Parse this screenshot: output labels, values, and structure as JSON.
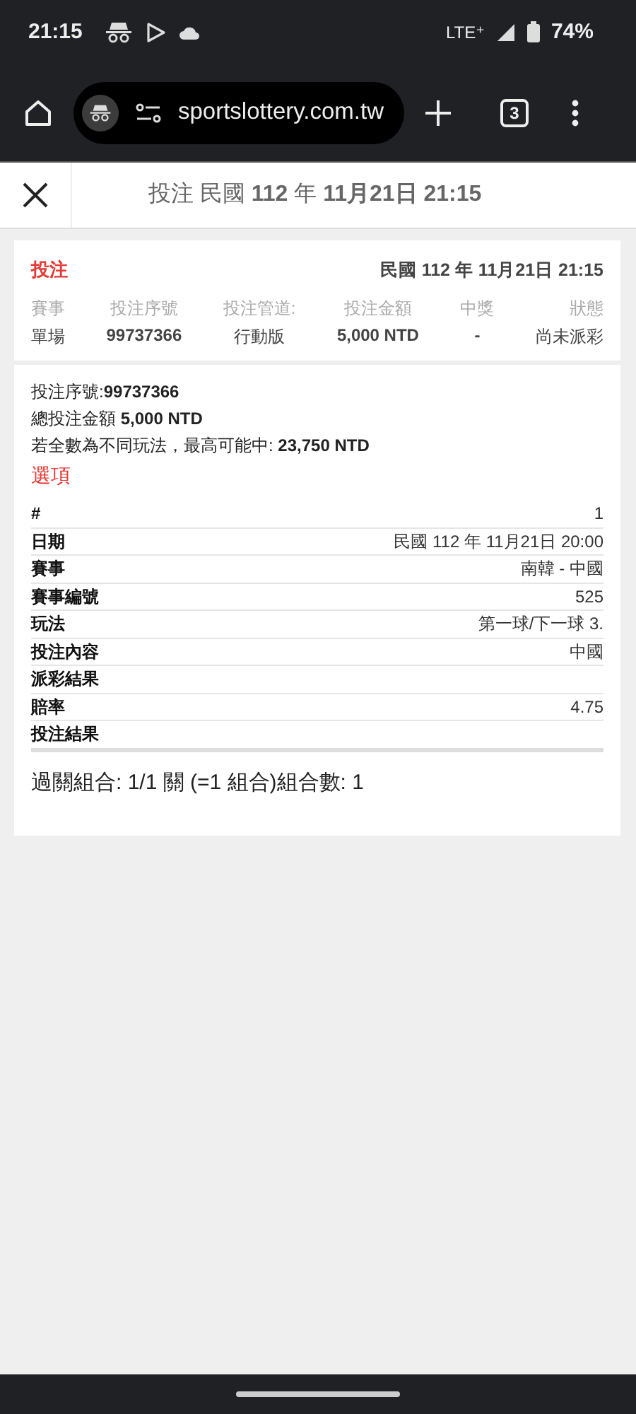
{
  "status_bar": {
    "time": "21:15",
    "network": "LTE⁺",
    "battery": "74%"
  },
  "browser": {
    "url": "sportslottery.com.tw",
    "tab_count": "3"
  },
  "header": {
    "title": "投注 民國 **112** 年 **11月21日 21:15**"
  },
  "card": {
    "type_label": "投注",
    "datetime": "民國 112 年 11月21日 21:15",
    "columns": [
      {
        "heading": "賽事",
        "value": "單場"
      },
      {
        "heading": "投注序號",
        "value": "99737366"
      },
      {
        "heading": "投注管道:",
        "value": "行動版"
      },
      {
        "heading": "投注金額",
        "value": "5,000 NTD"
      },
      {
        "heading": "中獎",
        "value": "-"
      },
      {
        "heading": "狀態",
        "value": "尚未派彩"
      }
    ],
    "summary": [
      "投注序號:**99737366**",
      "總投注金額 **5,000 NTD**",
      "若全數為不同玩法，最高可能中: **23,750 NTD**"
    ],
    "options_heading": "選項",
    "details": [
      {
        "label": "#",
        "value": "1"
      },
      {
        "label": "日期",
        "value": "民國 112 年 11月21日 20:00"
      },
      {
        "label": "賽事",
        "value": "南韓 - 中國"
      },
      {
        "label": "賽事編號",
        "value": "525"
      },
      {
        "label": "玩法",
        "value": "第一球/下一球 3."
      },
      {
        "label": "投注內容",
        "value": "中國"
      },
      {
        "label": "派彩結果"
      },
      {
        "label": "賠率",
        "value": "4.75"
      },
      {
        "label": "投注結果"
      }
    ],
    "combination": "過關組合: 1/1 關 (=1 組合)組合數: 1"
  }
}
